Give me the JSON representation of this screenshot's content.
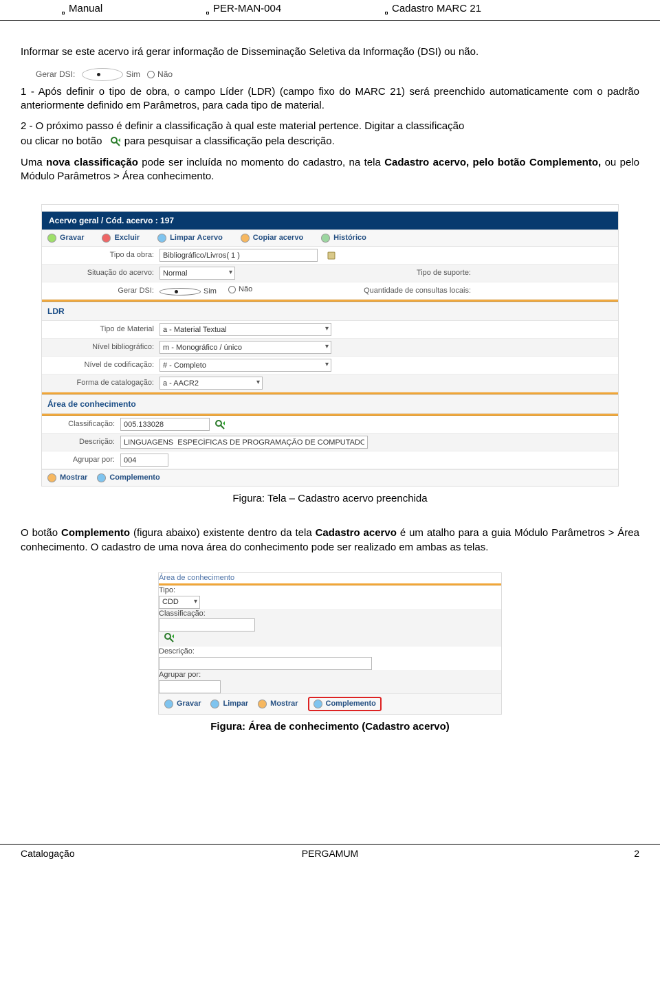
{
  "header": {
    "col1": "Manual",
    "col2": "PER-MAN-004",
    "col3": "Cadastro MARC 21"
  },
  "body": {
    "p1": "Informar se este acervo irá gerar informação de Disseminação Seletiva da Informação (DSI) ou não.",
    "dsi_inline": {
      "label": "Gerar DSI:",
      "opt_sim": "Sim",
      "opt_nao": "Não"
    },
    "p2": "1 - Após definir o tipo de obra, o campo Líder (LDR) (campo fixo do MARC 21) será preenchido automaticamente com o padrão anteriormente definido em Parâmetros, para cada tipo de material.",
    "p3a": "2 - O próximo passo é definir a classificação à qual este material pertence. Digitar a classificação",
    "p3b_prefix": "ou clicar no botão ",
    "p3b_suffix": " para pesquisar a classificação pela descrição.",
    "p4": "Uma nova classificação pode ser incluída no momento do cadastro, na tela Cadastro acervo, pelo botão Complemento, ou pelo Módulo Parâmetros > Área conhecimento."
  },
  "mock1": {
    "title": "Acervo geral / Cód. acervo : 197",
    "toolbar": {
      "gravar": "Gravar",
      "excluir": "Excluir",
      "limpar": "Limpar Acervo",
      "copiar": "Copiar acervo",
      "historico": "Histórico"
    },
    "row_tipo_obra": {
      "label": "Tipo da obra:",
      "value": "Bibliográfico/Livros( 1 )"
    },
    "row_situacao": {
      "label": "Situação do acervo:",
      "value": "Normal",
      "label2": "Tipo de suporte:"
    },
    "row_dsi": {
      "label": "Gerar DSI:",
      "sim": "Sim",
      "nao": "Não",
      "label2": "Quantidade de consultas locais:"
    },
    "ldr": {
      "head": "LDR",
      "tipo_mat": {
        "label": "Tipo de Material",
        "value": "a - Material Textual"
      },
      "nivel_bib": {
        "label": "Nível bibliográfico:",
        "value": "m - Monográfico / único"
      },
      "nivel_cod": {
        "label": "Nível de codificação:",
        "value": "# - Completo"
      },
      "forma_cat": {
        "label": "Forma de catalogação:",
        "value": "a - AACR2"
      }
    },
    "area": {
      "head": "Área de conhecimento",
      "classif": {
        "label": "Classificação:",
        "value": "005.133028"
      },
      "descr": {
        "label": "Descrição:",
        "value": "LINGUAGENS  ESPECÍFICAS DE PROGRAMAÇÃO DE COMPUTADO"
      },
      "agrupar": {
        "label": "Agrupar por:",
        "value": "004"
      },
      "mostrar": "Mostrar",
      "complemento": "Complemento"
    },
    "caption": "Figura: Tela – Cadastro acervo preenchida"
  },
  "mid_paragraph": "O botão Complemento (figura abaixo) existente dentro da tela Cadastro acervo é um atalho para a guia Módulo Parâmetros > Área conhecimento. O cadastro de uma nova área do conhecimento pode ser realizado em ambas as telas.",
  "mock2": {
    "head": "Área de conhecimento",
    "tipo": {
      "label": "Tipo:",
      "value": "CDD"
    },
    "classif": {
      "label": "Classificação:",
      "value": ""
    },
    "descr": {
      "label": "Descrição:",
      "value": ""
    },
    "agrupar": {
      "label": "Agrupar por:",
      "value": ""
    },
    "btns": {
      "gravar": "Gravar",
      "limpar": "Limpar",
      "mostrar": "Mostrar",
      "complemento": "Complemento"
    },
    "caption": "Figura: Área de conhecimento (Cadastro acervo)"
  },
  "footer": {
    "left": "Catalogação",
    "center": "PERGAMUM",
    "right": "2"
  }
}
